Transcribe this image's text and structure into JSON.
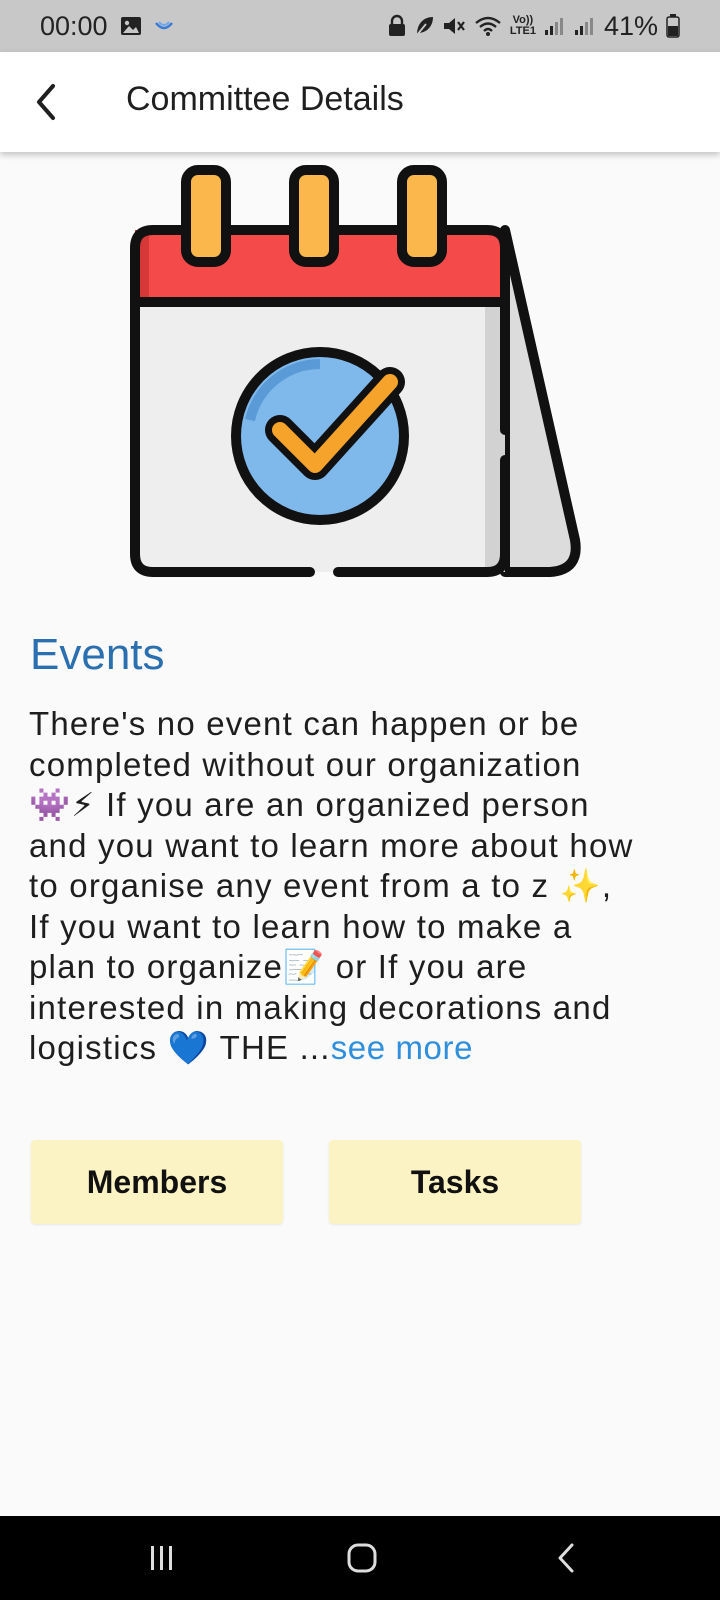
{
  "status_bar": {
    "time": "00:00",
    "volte_top": "Vo))",
    "volte_bottom": "LTE1",
    "battery": "41%",
    "icons": [
      "gallery-icon",
      "notification-app-icon",
      "lock-icon",
      "leaf-icon",
      "mute-icon",
      "wifi-icon",
      "signal-icon",
      "signal-icon",
      "battery-icon"
    ]
  },
  "app_bar": {
    "title": "Committee Details",
    "back_icon": "chevron-left-icon"
  },
  "hero": {
    "icon": "calendar-check-icon"
  },
  "committee": {
    "name": "Events",
    "desc_lines": [
      "There's no event can happen or be",
      "completed without our organization",
      "👾⚡ If you are an organized person",
      "and you want to learn more about how",
      "to organise any event from a to z ✨,",
      "If you want to learn how to make a",
      "plan to organize📝 or If you are",
      "interested in making decorations and",
      "logistics 💙 THE ..."
    ],
    "see_more": "see more"
  },
  "buttons": {
    "members": "Members",
    "tasks": "Tasks"
  },
  "nav": {
    "items": [
      "recent-apps-icon",
      "home-icon",
      "back-icon"
    ]
  }
}
